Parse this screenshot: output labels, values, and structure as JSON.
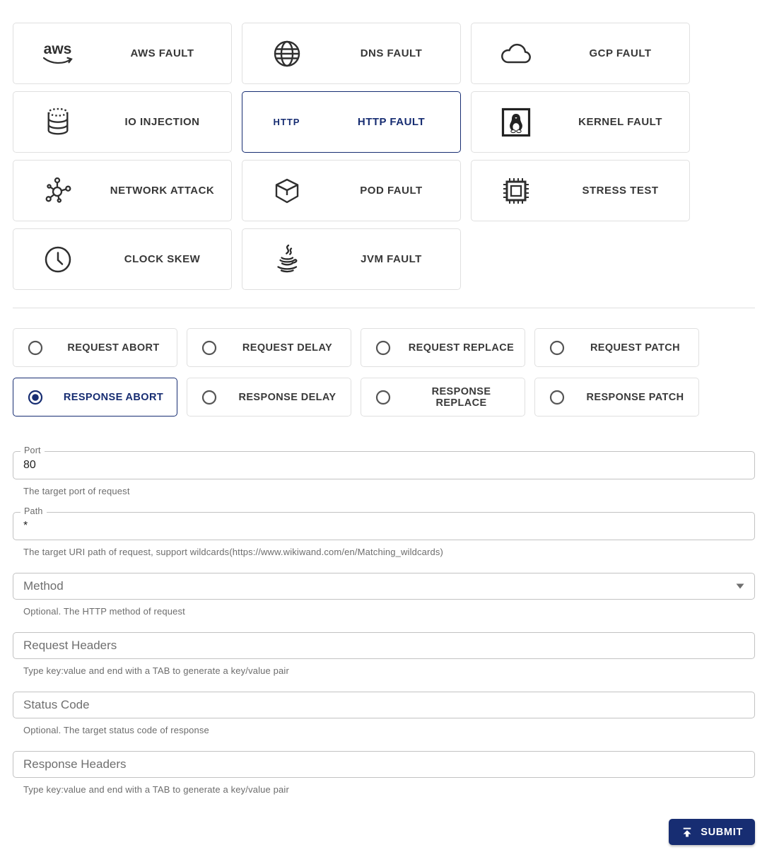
{
  "theme": {
    "primary": "#172d72",
    "card_border": "#e0e0e0",
    "label_text": "#373737",
    "helper_text": "#6d6d6d"
  },
  "fault_types": [
    {
      "label": "AWS FAULT",
      "icon": "aws-icon",
      "selected": false
    },
    {
      "label": "DNS FAULT",
      "icon": "globe-icon",
      "selected": false
    },
    {
      "label": "GCP FAULT",
      "icon": "cloud-icon",
      "selected": false
    },
    {
      "label": "IO INJECTION",
      "icon": "database-icon",
      "selected": false
    },
    {
      "label": "HTTP FAULT",
      "icon": "http-text-icon",
      "icon_text": "HTTP",
      "selected": true
    },
    {
      "label": "KERNEL FAULT",
      "icon": "tux-icon",
      "selected": false
    },
    {
      "label": "NETWORK ATTACK",
      "icon": "network-nodes-icon",
      "selected": false
    },
    {
      "label": "POD FAULT",
      "icon": "cube-icon",
      "selected": false
    },
    {
      "label": "STRESS TEST",
      "icon": "cpu-chip-icon",
      "selected": false
    },
    {
      "label": "CLOCK SKEW",
      "icon": "clock-icon",
      "selected": false
    },
    {
      "label": "JVM FAULT",
      "icon": "java-cup-icon",
      "selected": false
    }
  ],
  "http_actions": [
    {
      "label": "REQUEST ABORT",
      "selected": false
    },
    {
      "label": "REQUEST DELAY",
      "selected": false
    },
    {
      "label": "REQUEST REPLACE",
      "selected": false
    },
    {
      "label": "REQUEST PATCH",
      "selected": false
    },
    {
      "label": "RESPONSE ABORT",
      "selected": true
    },
    {
      "label": "RESPONSE DELAY",
      "selected": false
    },
    {
      "label": "RESPONSE REPLACE",
      "selected": false
    },
    {
      "label": "RESPONSE PATCH",
      "selected": false
    }
  ],
  "form": {
    "fields": [
      {
        "label": "Port",
        "value": "80",
        "helper": "The target port of request",
        "type": "text"
      },
      {
        "label": "Path",
        "value": "*",
        "helper": "The target URI path of request, support wildcards(https://www.wikiwand.com/en/Matching_wildcards)",
        "type": "text"
      },
      {
        "label": "Method",
        "value": "",
        "helper": "Optional. The HTTP method of request",
        "type": "select"
      },
      {
        "label": "Request Headers",
        "value": "",
        "helper": "Type key:value and end with a TAB to generate a key/value pair",
        "type": "text"
      },
      {
        "label": "Status Code",
        "value": "",
        "helper": "Optional. The target status code of response",
        "type": "text"
      },
      {
        "label": "Response Headers",
        "value": "",
        "helper": "Type key:value and end with a TAB to generate a key/value pair",
        "type": "text"
      }
    ],
    "submit_label": "SUBMIT"
  }
}
